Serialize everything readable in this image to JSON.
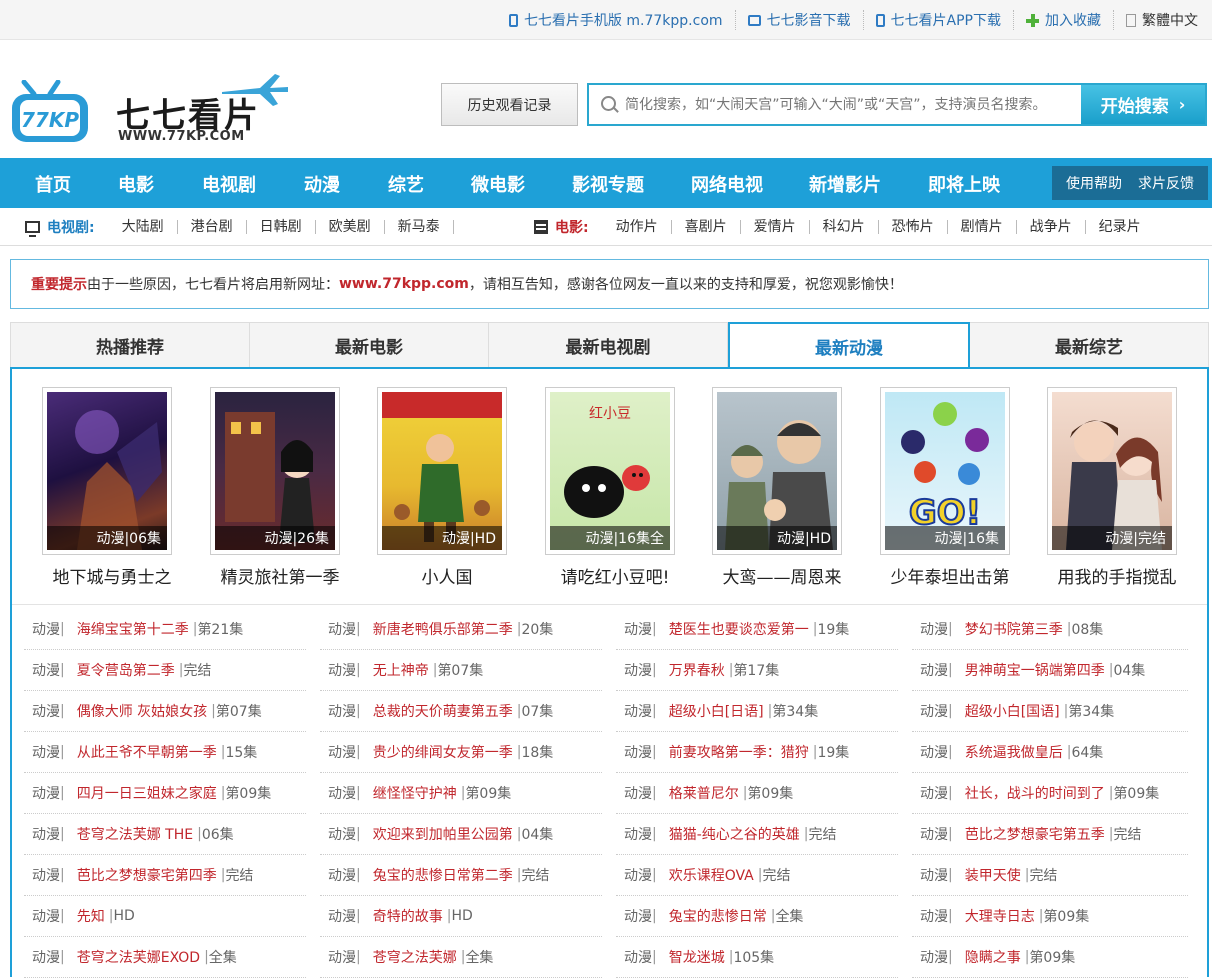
{
  "toplinks": [
    {
      "label": "七七看片手机版 m.77kpp.com",
      "icon": "phone-icon"
    },
    {
      "label": "七七影音下载",
      "icon": "computer-icon"
    },
    {
      "label": "七七看片APP下载",
      "icon": "phone-icon"
    },
    {
      "label": "加入收藏",
      "icon": "plus-icon"
    },
    {
      "label": "繁體中文",
      "icon": "document-icon"
    }
  ],
  "logo": {
    "badge": "77KP",
    "name": "七七看片",
    "url": "WWW.77KP.COM"
  },
  "header": {
    "history_label": "历史观看记录",
    "search_placeholder": "简化搜索，如“大闹天宫”可输入“大闹”或“天宫”，支持演员名搜索。",
    "search_button": "开始搜索"
  },
  "mainnav": {
    "items": [
      "首页",
      "电影",
      "电视剧",
      "动漫",
      "综艺",
      "微电影",
      "影视专题",
      "网络电视",
      "新增影片",
      "即将上映"
    ],
    "help": "使用帮助",
    "feedback": "求片反馈"
  },
  "subnav": {
    "tv_label": "电视剧:",
    "tv_items": [
      "大陆剧",
      "港台剧",
      "日韩剧",
      "欧美剧",
      "新马泰"
    ],
    "movie_label": "电影:",
    "movie_items": [
      "动作片",
      "喜剧片",
      "爱情片",
      "科幻片",
      "恐怖片",
      "剧情片",
      "战争片",
      "纪录片"
    ]
  },
  "notice": {
    "lead": "重要提示",
    "text1": "由于一些原因，七七看片将启用新网址：",
    "url": "www.77kpp.com",
    "text2": "，请相互告知，感谢各位网友一直以来的支持和厚爱，祝您观影愉快！"
  },
  "tabs": [
    "热播推荐",
    "最新电影",
    "最新电视剧",
    "最新动漫",
    "最新综艺"
  ],
  "active_tab": "最新动漫",
  "posters": [
    {
      "title": "地下城与勇士之",
      "caption": "动漫|06集"
    },
    {
      "title": "精灵旅社第一季",
      "caption": "动漫|26集"
    },
    {
      "title": "小人国",
      "caption": "动漫|HD"
    },
    {
      "title": "请吃红小豆吧!",
      "caption": "动漫|16集全"
    },
    {
      "title": "大鸾——周恩来",
      "caption": "动漫|HD"
    },
    {
      "title": "少年泰坦出击第",
      "caption": "动漫|16集"
    },
    {
      "title": "用我的手指搅乱",
      "caption": "动漫|完结"
    }
  ],
  "list_rows": [
    [
      [
        "海绵宝宝第十二季",
        "第21集"
      ],
      [
        "新唐老鸭俱乐部第二季",
        "20集"
      ],
      [
        "楚医生也要谈恋爱第一",
        "19集"
      ],
      [
        "梦幻书院第三季",
        "08集"
      ]
    ],
    [
      [
        "夏令营岛第二季",
        "完结"
      ],
      [
        "无上神帝",
        "第07集"
      ],
      [
        "万界春秋",
        "第17集"
      ],
      [
        "男神萌宝一锅端第四季",
        "04集"
      ]
    ],
    [
      [
        "偶像大师 灰姑娘女孩",
        "第07集"
      ],
      [
        "总裁的天价萌妻第五季",
        "07集"
      ],
      [
        "超级小白[日语]",
        "第34集"
      ],
      [
        "超级小白[国语]",
        "第34集"
      ]
    ],
    [
      [
        "从此王爷不早朝第一季",
        "15集"
      ],
      [
        "贵少的绯闻女友第一季",
        "18集"
      ],
      [
        "前妻攻略第一季：猎狩",
        "19集"
      ],
      [
        "系统逼我做皇后",
        "64集"
      ]
    ],
    [
      [
        "四月一日三姐妹之家庭",
        "第09集"
      ],
      [
        "继怪怪守护神",
        "第09集"
      ],
      [
        "格莱普尼尔",
        "第09集"
      ],
      [
        "社长，战斗的时间到了",
        "第09集"
      ]
    ],
    [
      [
        "苍穹之法芙娜 THE",
        "06集"
      ],
      [
        "欢迎来到加帕里公园第",
        "04集"
      ],
      [
        "猫猫-纯心之谷的英雄",
        "完结"
      ],
      [
        "芭比之梦想豪宅第五季",
        "完结"
      ]
    ],
    [
      [
        "芭比之梦想豪宅第四季",
        "完结"
      ],
      [
        "兔宝的悲惨日常第二季",
        "完结"
      ],
      [
        "欢乐课程OVA",
        "完结"
      ],
      [
        "装甲天使",
        "完结"
      ]
    ],
    [
      [
        "先知",
        "HD"
      ],
      [
        "奇特的故事",
        "HD"
      ],
      [
        "兔宝的悲惨日常",
        "全集"
      ],
      [
        "大理寺日志",
        "第09集"
      ]
    ],
    [
      [
        "苍穹之法芙娜EXOD",
        "全集"
      ],
      [
        "苍穹之法芙娜",
        "全集"
      ],
      [
        "智龙迷城",
        "105集"
      ],
      [
        "隐瞒之事",
        "第09集"
      ]
    ]
  ],
  "list_category": "动漫",
  "colors": {
    "accent": "#1ea0d8",
    "link_red": "#c1272d",
    "link_blue": "#2a6fb0"
  }
}
